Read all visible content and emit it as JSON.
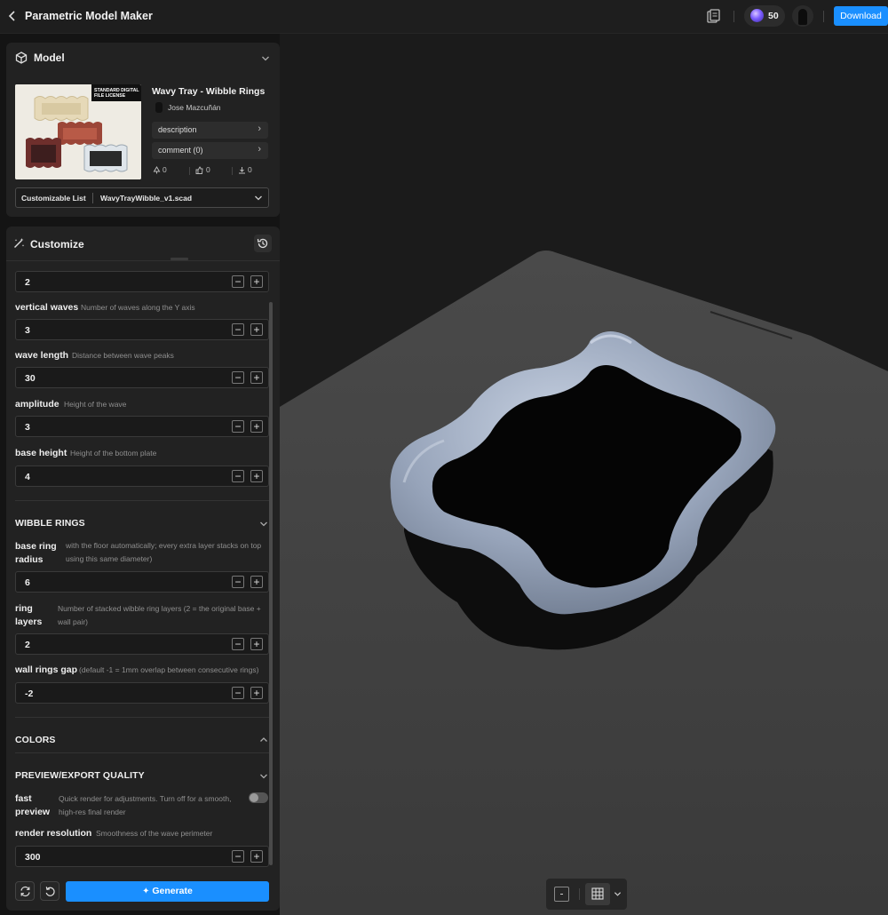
{
  "header": {
    "title": "Parametric Model Maker",
    "credits": "50",
    "download_label": "Download"
  },
  "model_panel": {
    "title": "Model",
    "thumbnail_badge": "STANDARD DIGITAL FILE LICENSE",
    "model_name": "Wavy Tray - Wibble Rings",
    "author": "Jose Mazcuñán",
    "description_label": "description",
    "comment_label": "comment  (0)",
    "stats": {
      "likes": "0",
      "thumbs": "0",
      "downloads": "0"
    },
    "list_label": "Customizable List",
    "file_name": "WavyTrayWibble_v1.scad"
  },
  "customize": {
    "title": "Customize",
    "params": [
      {
        "label": "",
        "desc": "",
        "value": "2"
      },
      {
        "label": "vertical waves",
        "desc": "Number of waves along the Y axis",
        "value": "3"
      },
      {
        "label": "wave length",
        "desc": "Distance between wave peaks",
        "value": "30"
      },
      {
        "label": "amplitude",
        "desc": "Height of the wave",
        "value": "3"
      },
      {
        "label": "base height",
        "desc": "Height of the bottom plate",
        "value": "4"
      }
    ],
    "wibble": {
      "title": "WIBBLE RINGS",
      "params": [
        {
          "label": "base ring radius",
          "desc": "with the floor automatically; every extra layer stacks on top using this same diameter)",
          "value": "6"
        },
        {
          "label": "ring layers",
          "desc": "Number of stacked wibble ring layers (2 = the original base + wall pair)",
          "value": "2"
        },
        {
          "label": "wall rings gap",
          "desc": "(default -1 = 1mm overlap between consecutive rings)",
          "value": "-2"
        }
      ]
    },
    "colors_title": "COLORS",
    "quality": {
      "title": "PREVIEW/EXPORT QUALITY",
      "fast_preview_label": "fast preview",
      "fast_preview_desc": "Quick render for adjustments. Turn off for a smooth, high-res final render",
      "fast_preview_on": false,
      "resolution_label": "render resolution",
      "resolution_desc": "Smoothness of the wave perimeter",
      "resolution_value": "300"
    },
    "generate_label": "Generate"
  },
  "colors": {
    "accent": "#1a8fff",
    "tray": "#9aa7bd",
    "plate": "#3f3f3f"
  }
}
